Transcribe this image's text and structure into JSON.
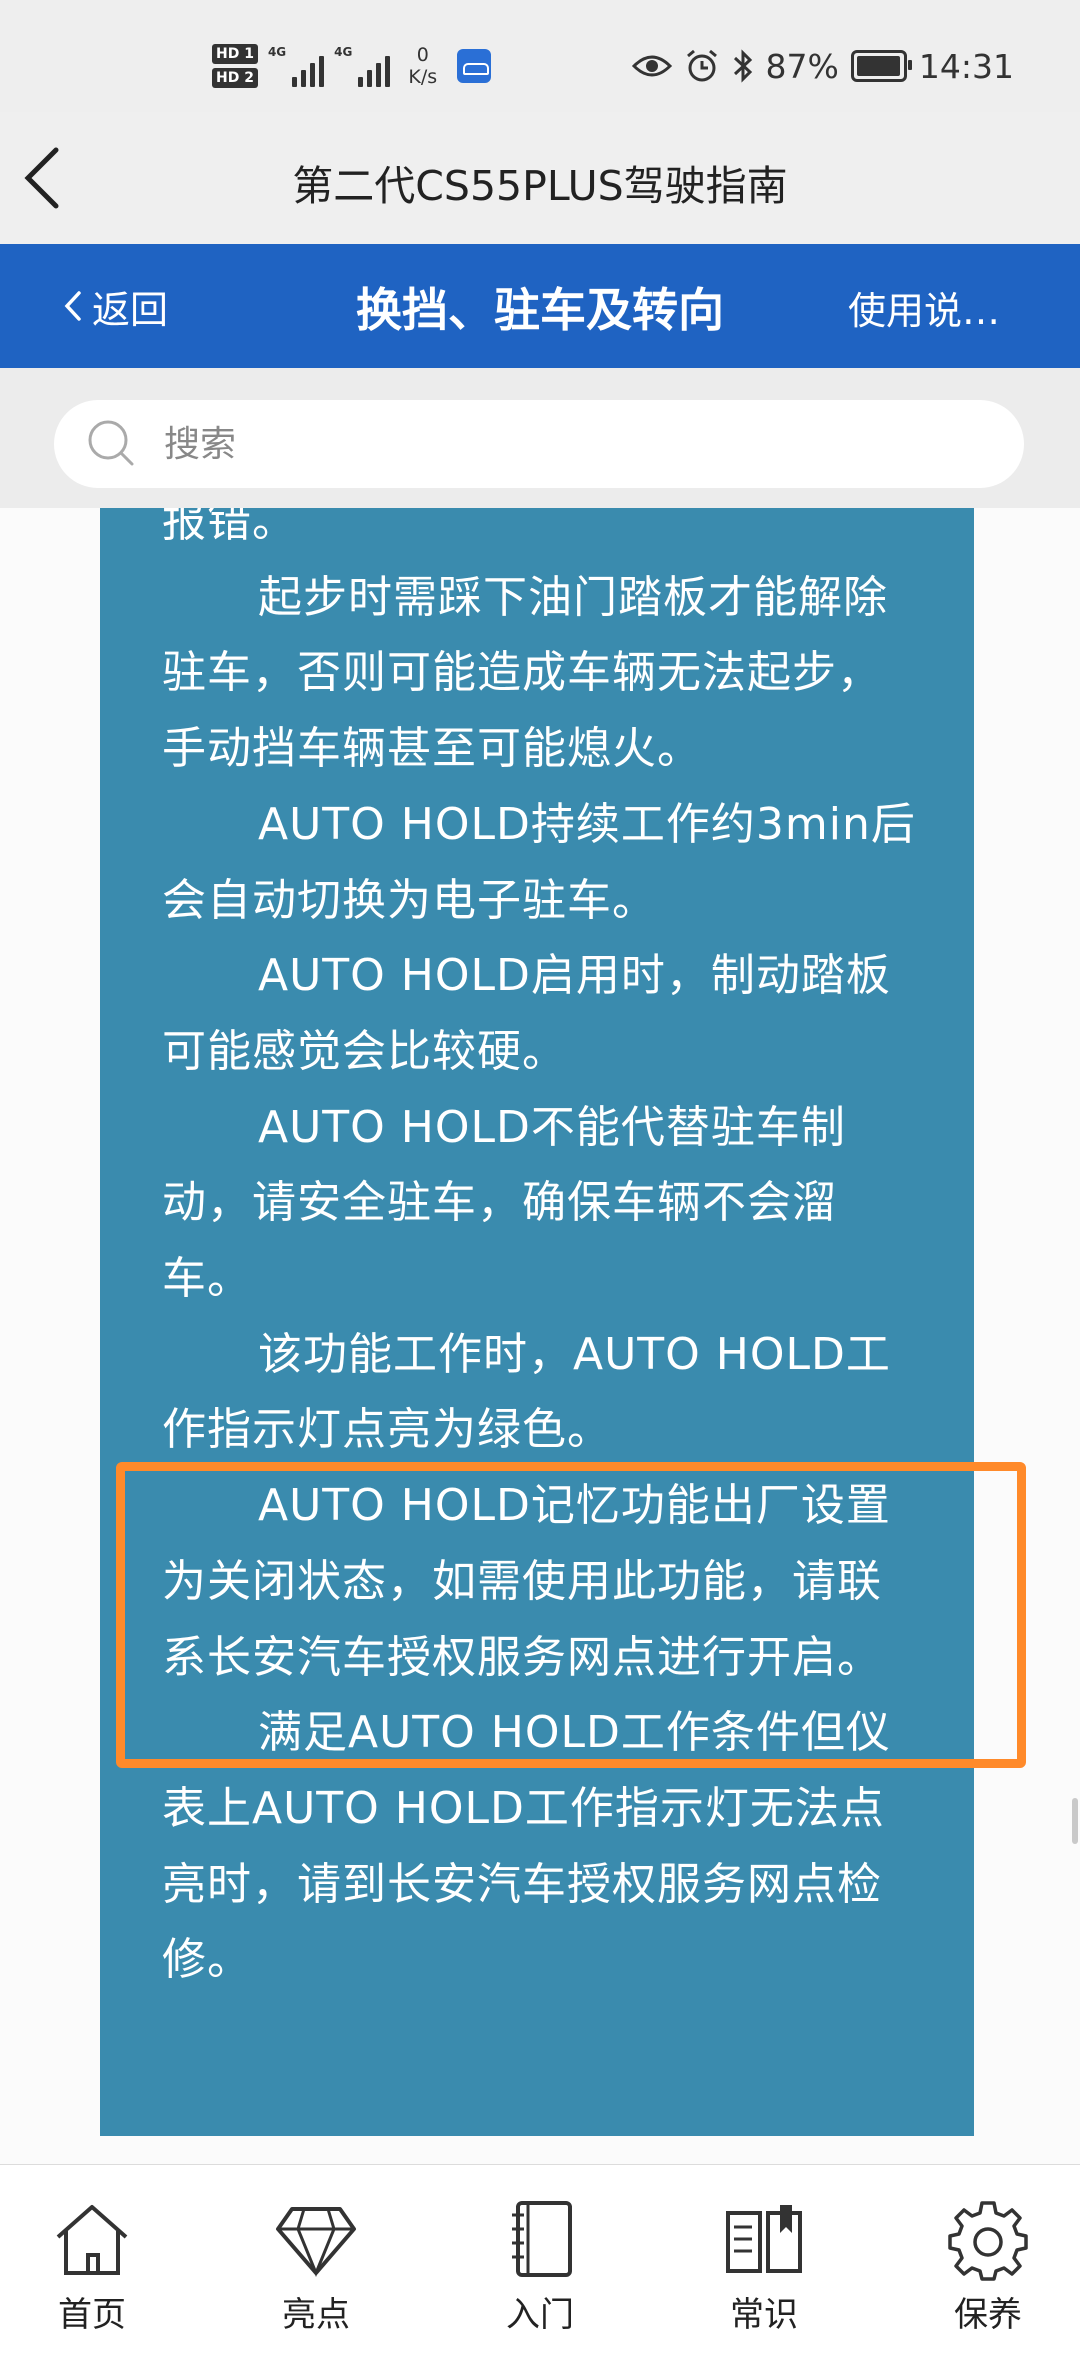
{
  "status_bar": {
    "sim1": "HD 1",
    "sim2": "HD 2",
    "network1": "4G",
    "network2": "4G",
    "speed_value": "0",
    "speed_unit": "K/s",
    "battery_percent": "87%",
    "time": "14:31"
  },
  "title_bar": {
    "title": "第二代CS55PLUS驾驶指南"
  },
  "nav": {
    "back_label": "返回",
    "title": "换挡、驻车及转向",
    "right_label": "使用说…"
  },
  "search": {
    "placeholder": "搜索"
  },
  "content": {
    "partial_top": "报错。",
    "paragraphs": [
      "起步时需踩下油门踏板才能解除驻车，否则可能造成车辆无法起步，手动挡车辆甚至可能熄火。",
      "AUTO HOLD持续工作约3min后会自动切换为电子驻车。",
      "AUTO HOLD启用时，制动踏板可能感觉会比较硬。",
      "AUTO HOLD不能代替驻车制动，请安全驻车，确保车辆不会溜车。",
      "该功能工作时，AUTO HOLD工作指示灯点亮为绿色。",
      "AUTO HOLD记忆功能出厂设置为关闭状态，如需使用此功能，请联系长安汽车授权服务网点进行开启。",
      "满足AUTO HOLD工作条件但仪表上AUTO HOLD工作指示灯无法点亮时，请到长安汽车授权服务网点检修。"
    ]
  },
  "tabs": [
    {
      "label": "首页",
      "icon": "home-icon"
    },
    {
      "label": "亮点",
      "icon": "diamond-icon"
    },
    {
      "label": "入门",
      "icon": "notebook-icon"
    },
    {
      "label": "常识",
      "icon": "book-icon"
    },
    {
      "label": "保养",
      "icon": "gear-icon"
    }
  ],
  "colors": {
    "nav_blue": "#1f63c2",
    "content_teal": "#3a8bae",
    "highlight_orange": "#ff8a2a"
  }
}
